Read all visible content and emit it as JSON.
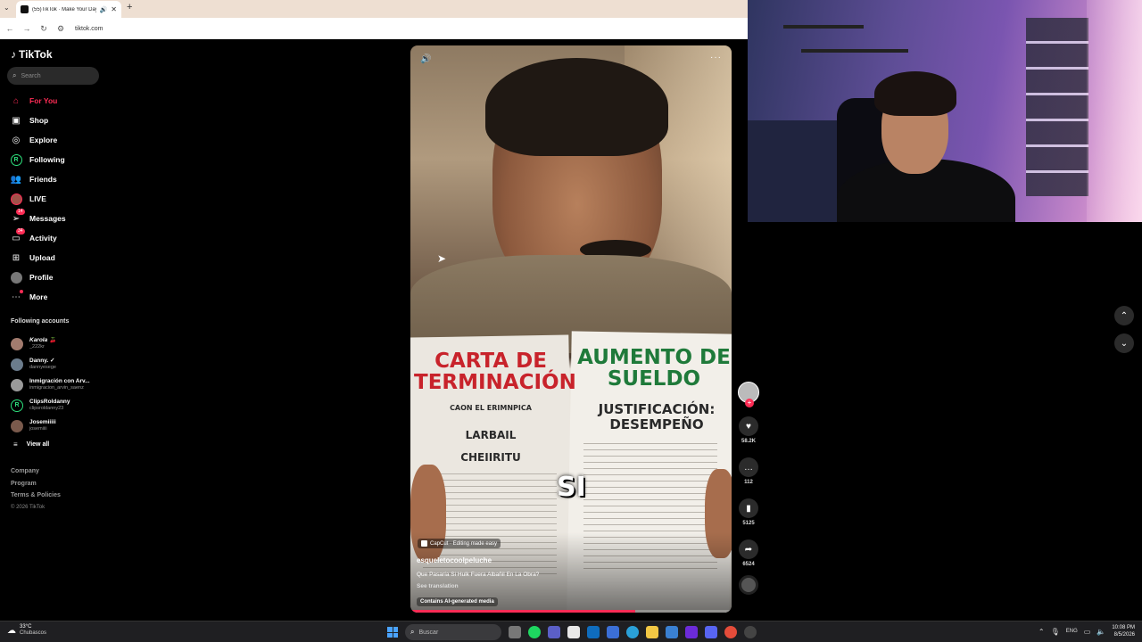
{
  "browser": {
    "tab_title": "(55)TikTok · Make Your Day",
    "url": "tiktok.com"
  },
  "tiktok": {
    "logo": "TikTok",
    "search_placeholder": "Search",
    "nav": [
      {
        "label": "For You",
        "icon": "home-icon",
        "active": true
      },
      {
        "label": "Shop",
        "icon": "shop-bag-icon"
      },
      {
        "label": "Explore",
        "icon": "compass-icon"
      },
      {
        "label": "Following",
        "icon": "following-icon"
      },
      {
        "label": "Friends",
        "icon": "friends-icon"
      },
      {
        "label": "LIVE",
        "icon": "live-icon"
      },
      {
        "label": "Messages",
        "icon": "messages-icon",
        "badge": "14"
      },
      {
        "label": "Activity",
        "icon": "activity-icon",
        "badge": "34"
      },
      {
        "label": "Upload",
        "icon": "upload-icon"
      },
      {
        "label": "Profile",
        "icon": "profile-avatar"
      },
      {
        "label": "More",
        "icon": "more-icon"
      }
    ],
    "following_title": "Following accounts",
    "accounts": [
      {
        "name": "Karola 🍒",
        "handle": "_222kr"
      },
      {
        "name": "Danny. ✓",
        "handle": "dannyesege"
      },
      {
        "name": "Inmigración con Arv...",
        "handle": "inmigracion_arvin_saenz"
      },
      {
        "name": "ClipsRoldanny",
        "handle": "clipsroldanny23"
      },
      {
        "name": "Josemiiiii",
        "handle": "josemiiii"
      }
    ],
    "view_all": "View all",
    "footer": [
      "Company",
      "Program",
      "Terms & Policies"
    ],
    "copyright": "© 2026 TikTok"
  },
  "video": {
    "doc_left_title": "CARTA DE TERMINACIÓN",
    "doc_left_sub1": "CAON EL ERIMNPICA",
    "doc_left_sub2": "LARBAIL",
    "doc_left_sub3": "CHEIIRITU",
    "doc_right_title": "AUMENTO DE SUELDO",
    "doc_right_sub": "JUSTIFICACIÓN: DESEMPEÑO",
    "caption": "SI",
    "capcut": "CapCut · Editing made easy",
    "username": "esqueletocoolpeluche",
    "description": "Que Pasaría Si Hulk Fuera Albañil En La Obra?",
    "see_translation": "See translation",
    "ai_label": "Contains AI-generated media",
    "progress": 0.7
  },
  "rail": {
    "likes": "58.2K",
    "comments": "112",
    "saves": "5125",
    "shares": "6524"
  },
  "taskbar": {
    "temp": "33°C",
    "weather": "Chubascos",
    "search_placeholder": "Buscar",
    "lang": "ENG",
    "time": "10:08 PM",
    "date": "8/5/2026"
  },
  "colors": {
    "tiktok_red": "#fe2c55",
    "following_green": "#2de07c"
  }
}
